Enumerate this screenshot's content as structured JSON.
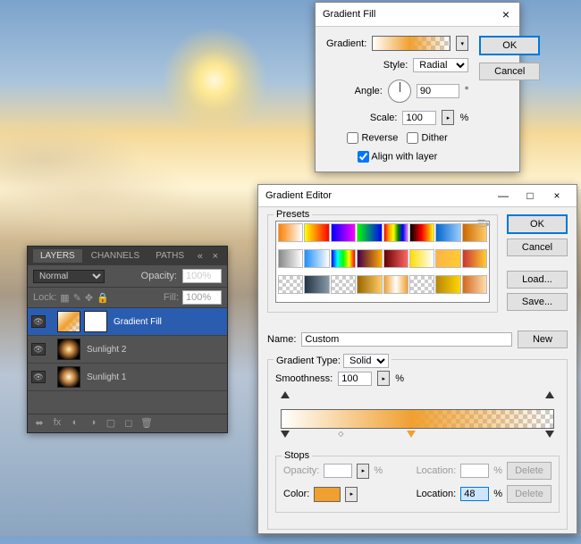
{
  "layersPanel": {
    "tabs": [
      "LAYERS",
      "CHANNELS",
      "PATHS"
    ],
    "blendMode": "Normal",
    "opacityLabel": "Opacity:",
    "opacityVal": "100%",
    "lockLabel": "Lock:",
    "fillLabel": "Fill:",
    "fillVal": "100%",
    "layers": [
      {
        "name": "Gradient Fill",
        "selected": true,
        "mask": true,
        "thumbClass": "grad-thumb"
      },
      {
        "name": "Sunlight 2",
        "selected": false,
        "mask": false,
        "thumbClass": "sun-thumb"
      },
      {
        "name": "Sunlight 1",
        "selected": false,
        "mask": false,
        "thumbClass": "sun-thumb2"
      }
    ]
  },
  "gradientFill": {
    "title": "Gradient Fill",
    "gradientLabel": "Gradient:",
    "styleLabel": "Style:",
    "styleVal": "Radial",
    "angleLabel": "Angle:",
    "angleVal": "90",
    "scaleLabel": "Scale:",
    "scaleVal": "100",
    "reverseLabel": "Reverse",
    "ditherLabel": "Dither",
    "alignLabel": "Align with layer",
    "ok": "OK",
    "cancel": "Cancel"
  },
  "editor": {
    "title": "Gradient Editor",
    "presetsLabel": "Presets",
    "nameLabel": "Name:",
    "nameVal": "Custom",
    "newBtn": "New",
    "gradTypeLabel": "Gradient Type:",
    "gradTypeVal": "Solid",
    "smoothLabel": "Smoothness:",
    "smoothVal": "100",
    "stopsLabel": "Stops",
    "opacityLabel": "Opacity:",
    "locationLabel": "Location:",
    "locationVal": "48",
    "colorLabel": "Color:",
    "deleteBtn": "Delete",
    "ok": "OK",
    "cancel": "Cancel",
    "load": "Load...",
    "save": "Save...",
    "presets": [
      "linear-gradient(90deg,#ff7f00,#fff)",
      "linear-gradient(90deg,#ff0,#f00)",
      "linear-gradient(90deg,#00f,#f0f)",
      "linear-gradient(90deg,#0f0,#00f)",
      "linear-gradient(90deg,red,orange,yellow,green,blue,violet)",
      "linear-gradient(90deg,#000,#f00,#ff0)",
      "linear-gradient(90deg,#06c,#9cf)",
      "linear-gradient(90deg,#c60,#fc6)",
      "linear-gradient(90deg,#888,#fff)",
      "linear-gradient(90deg,#1e90ff,#fff)",
      "linear-gradient(90deg,#00f,#0ff,#0f0,#ff0,#f00)",
      "linear-gradient(90deg,#404,#fa0)",
      "linear-gradient(90deg,#600,#f66)",
      "linear-gradient(90deg,#fd0,#fff)",
      "linear-gradient(90deg,#ffb347,#ffcc33)",
      "linear-gradient(90deg,#c33,#fc3)",
      "repeating-conic-gradient(#ccc 0 25%,#fff 0 50%) 0 0/8px 8px",
      "linear-gradient(90deg,#234,#89a)",
      "repeating-conic-gradient(#ccc 0 25%,#fff 0 50%) 0 0/8px 8px",
      "linear-gradient(90deg,#960,#fc6)",
      "linear-gradient(90deg,#f0a030,#fff,#f0a030)",
      "repeating-conic-gradient(#ccc 0 25%,#fff 0 50%) 0 0/8px 8px",
      "linear-gradient(90deg,#b8860b,#ffd700)",
      "linear-gradient(90deg,#d2691e,#ffdead)"
    ]
  }
}
